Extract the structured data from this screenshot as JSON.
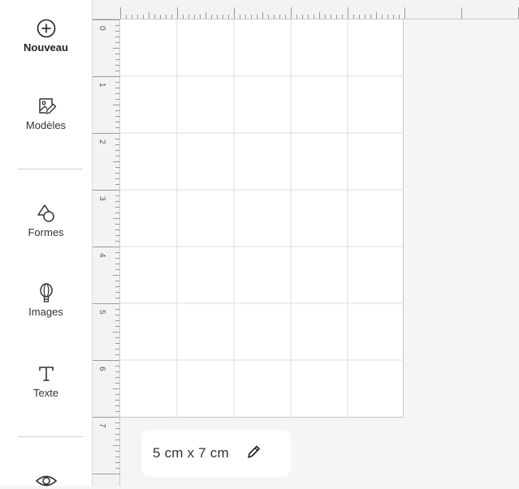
{
  "sidebar": {
    "items": [
      {
        "label": "Nouveau",
        "icon": "plus-circle-icon"
      },
      {
        "label": "Modèles",
        "icon": "image-edit-icon"
      },
      {
        "label": "Formes",
        "icon": "shapes-icon"
      },
      {
        "label": "Images",
        "icon": "balloon-icon"
      },
      {
        "label": "Texte",
        "icon": "text-t-icon"
      },
      {
        "label": "",
        "icon": "eye-icon"
      }
    ]
  },
  "ruler": {
    "vertical_labels": [
      "0",
      "1",
      "2",
      "3",
      "4",
      "5",
      "6",
      "7"
    ]
  },
  "canvas": {
    "size_label": "5 cm x 7 cm"
  },
  "colors": {
    "background": "#f5f5f5",
    "canvas": "#ffffff",
    "grid": "#dddddd",
    "ruler": "#f3f3f3"
  }
}
